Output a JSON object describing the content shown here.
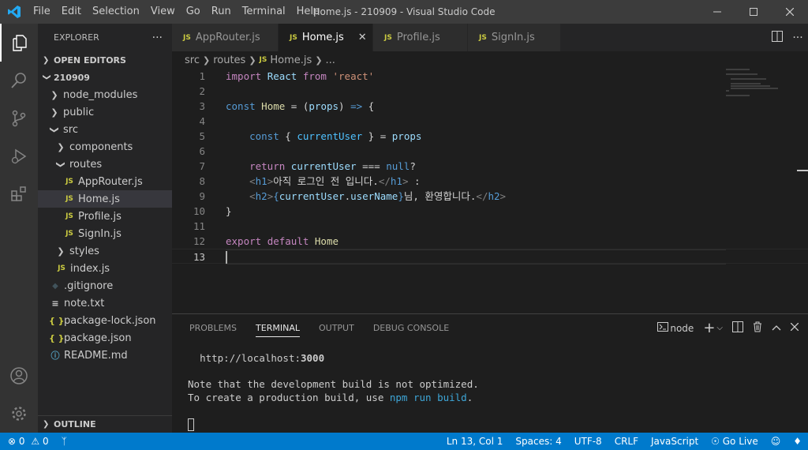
{
  "app": {
    "window_title": "Home.js - 210909 - Visual Studio Code",
    "menu": [
      "File",
      "Edit",
      "Selection",
      "View",
      "Go",
      "Run",
      "Terminal",
      "Help"
    ]
  },
  "sidebar": {
    "header": "EXPLORER",
    "more": "···",
    "open_editors": "OPEN EDITORS",
    "root": "210909",
    "tree": [
      {
        "label": "node_modules",
        "kind": "folder-closed",
        "depth": 1
      },
      {
        "label": "public",
        "kind": "folder-closed",
        "depth": 1
      },
      {
        "label": "src",
        "kind": "folder-open",
        "depth": 1
      },
      {
        "label": "components",
        "kind": "folder-closed",
        "depth": 2
      },
      {
        "label": "routes",
        "kind": "folder-open",
        "depth": 2
      },
      {
        "label": "AppRouter.js",
        "kind": "js",
        "depth": 3
      },
      {
        "label": "Home.js",
        "kind": "js",
        "depth": 3,
        "selected": true
      },
      {
        "label": "Profile.js",
        "kind": "js",
        "depth": 3
      },
      {
        "label": "SignIn.js",
        "kind": "js",
        "depth": 3
      },
      {
        "label": "styles",
        "kind": "folder-closed",
        "depth": 2
      },
      {
        "label": "index.js",
        "kind": "js",
        "depth": 2
      },
      {
        "label": ".gitignore",
        "kind": "git",
        "depth": 1
      },
      {
        "label": "note.txt",
        "kind": "txt",
        "depth": 1
      },
      {
        "label": "package-lock.json",
        "kind": "json",
        "depth": 1
      },
      {
        "label": "package.json",
        "kind": "json",
        "depth": 1
      },
      {
        "label": "README.md",
        "kind": "info",
        "depth": 1
      }
    ],
    "outline": "OUTLINE"
  },
  "tabs": [
    {
      "label": "AppRouter.js",
      "active": false
    },
    {
      "label": "Home.js",
      "active": true
    },
    {
      "label": "Profile.js",
      "active": false
    },
    {
      "label": "SignIn.js",
      "active": false
    }
  ],
  "js_badge": "JS",
  "breadcrumb": [
    "src",
    "routes",
    "Home.js",
    "..."
  ],
  "code": {
    "line_numbers": [
      "1",
      "2",
      "3",
      "4",
      "5",
      "6",
      "7",
      "8",
      "9",
      "10",
      "11",
      "12",
      "13"
    ],
    "current_line": 13
  },
  "panel": {
    "tabs": [
      "PROBLEMS",
      "TERMINAL",
      "OUTPUT",
      "DEBUG CONSOLE"
    ],
    "active_tab": "TERMINAL",
    "shell": "node",
    "terminal": {
      "url_prefix": "http://localhost:",
      "url_port": "3000",
      "note1": "Note that the development build is not optimized.",
      "note2_prefix": "To create a production build, use ",
      "note2_cmd": "npm run build",
      "note2_suffix": "."
    }
  },
  "status": {
    "errors": "0",
    "warnings": "0",
    "position": "Ln 13, Col 1",
    "spaces": "Spaces: 4",
    "encoding": "UTF-8",
    "eol": "CRLF",
    "language": "JavaScript",
    "golive": "Go Live"
  },
  "colors": {
    "statusbar": "#007acc",
    "activitybar": "#333333",
    "sidebar": "#252526",
    "editor": "#1e1e1e",
    "js_icon": "#cbcb41"
  }
}
